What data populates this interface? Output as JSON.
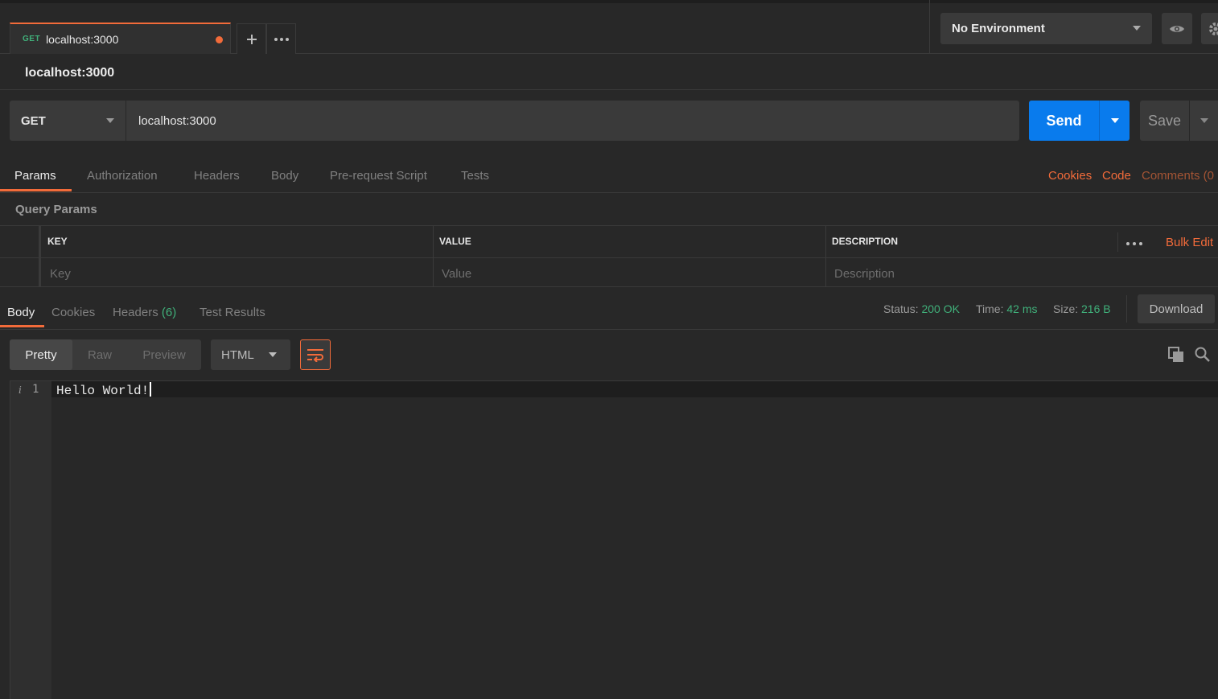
{
  "tabs": {
    "active": {
      "method": "GET",
      "name": "localhost:3000"
    },
    "add_icon": "plus-icon",
    "more_icon": "ellipsis-icon"
  },
  "environment": {
    "selected": "No Environment",
    "eye_icon": "eye-icon",
    "gear_icon": "gear-icon"
  },
  "request": {
    "name": "localhost:3000",
    "method": "GET",
    "url": "localhost:3000",
    "send_label": "Send",
    "save_label": "Save"
  },
  "request_tabs": {
    "items": [
      "Params",
      "Authorization",
      "Headers",
      "Body",
      "Pre-request Script",
      "Tests"
    ],
    "active": "Params",
    "links": {
      "cookies": "Cookies",
      "code": "Code",
      "comments": "Comments (0"
    }
  },
  "query_params": {
    "title": "Query Params",
    "columns": [
      "KEY",
      "VALUE",
      "DESCRIPTION"
    ],
    "placeholders": {
      "key": "Key",
      "value": "Value",
      "description": "Description"
    },
    "bulk_edit": "Bulk Edit"
  },
  "response": {
    "tabs": {
      "body": "Body",
      "cookies": "Cookies",
      "headers": "Headers",
      "headers_count": "(6)",
      "tests": "Test Results"
    },
    "status_label": "Status:",
    "status_value": "200 OK",
    "time_label": "Time:",
    "time_value": "42 ms",
    "size_label": "Size:",
    "size_value": "216 B",
    "download_label": "Download",
    "formats": [
      "Pretty",
      "Raw",
      "Preview"
    ],
    "active_format": "Pretty",
    "language": "HTML",
    "line_number": "1",
    "body_text": "Hello World!"
  },
  "colors": {
    "accent": "#f26b3a",
    "send_blue": "#097bed",
    "success_green": "#40b07a",
    "background": "#282828"
  }
}
